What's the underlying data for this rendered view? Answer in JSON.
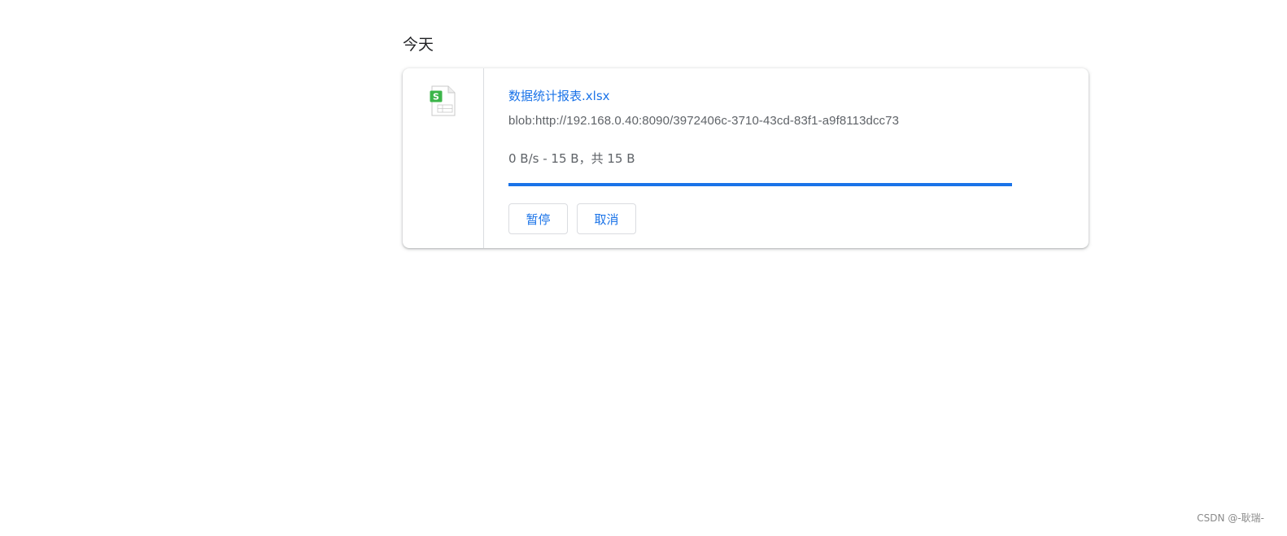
{
  "section": {
    "title": "今天"
  },
  "download": {
    "file_name": "数据统计报表.xlsx",
    "url": "blob:http://192.168.0.40:8090/3972406c-3710-43cd-83f1-a9f8113dcc73",
    "progress_text": "0 B/s - 15 B，共 15 B",
    "progress_fraction": 1.0,
    "file_icon": "spreadsheet-file-icon",
    "pause_label": "暂停",
    "cancel_label": "取消"
  },
  "colors": {
    "accent": "#1a73e8",
    "secondary_text": "#5f6368",
    "icon_green": "#3cb54a"
  },
  "watermark": "CSDN @-耿瑞-"
}
